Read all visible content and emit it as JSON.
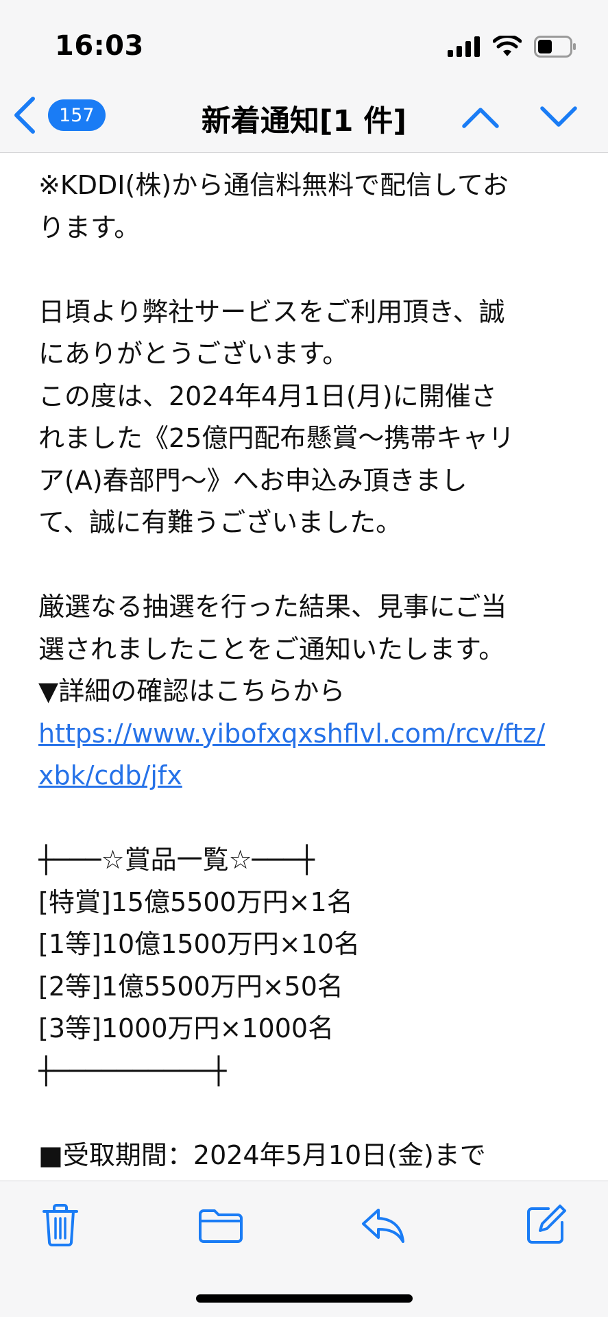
{
  "status_bar": {
    "time": "16:03"
  },
  "nav": {
    "unread_count": "157",
    "title": "新着通知[1 件]"
  },
  "message": {
    "lines": [
      "※KDDI(株)から通信料無料で配信してお",
      "ります。",
      "",
      "日頃より弊社サービスをご利用頂き、誠",
      "にありがとうございます。",
      "この度は、2024年4月1日(月)に開催さ",
      "れました《25億円配布懸賞〜携帯キャリ",
      "ア(A)春部門〜》へお申込み頂きまし",
      "て、誠に有難うございました。",
      "",
      "厳選なる抽選を行った結果、見事にご当",
      "選されましたことをご通知いたします。",
      "▼詳細の確認はこちらから"
    ],
    "link_lines": [
      "https://www.yibofxqxshflvl.com/rcv/ftz/",
      "xbk/cdb/jfx"
    ],
    "prize_lines": [
      "┼───☆賞品一覧☆───┼",
      "[特賞]15億5500万円×1名",
      "[1等]10億1500万円×10名",
      "[2等]1億5500万円×50名",
      "[3等]1000万円×1000名",
      "┼──────────┼"
    ],
    "deadline": "■受取期間：2024年5月10日(金)まで"
  },
  "icons": {
    "back": "chevron-left-icon",
    "prev": "chevron-up-icon",
    "next": "chevron-down-icon",
    "trash": "trash-icon",
    "folder": "folder-icon",
    "reply": "reply-icon",
    "compose": "compose-icon"
  },
  "colors": {
    "accent": "#1a7cf5",
    "link": "#2672e8",
    "bar_background": "#f6f6f7"
  }
}
